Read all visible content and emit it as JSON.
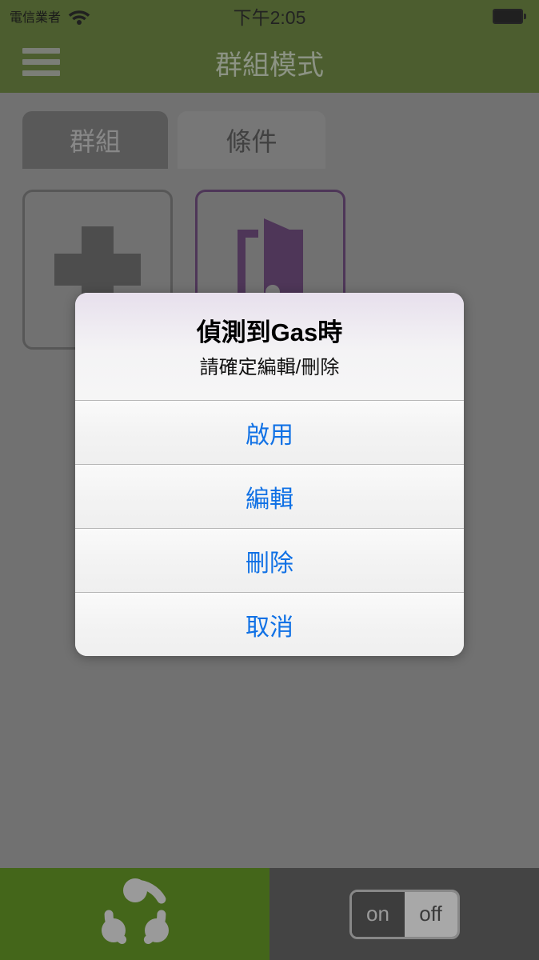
{
  "status_bar": {
    "carrier": "電信業者",
    "wifi_icon": "wifi-icon",
    "time": "下午2:05",
    "battery_icon": "battery-full-icon"
  },
  "nav_bar": {
    "menu_icon": "hamburger-menu-icon",
    "title": "群組模式"
  },
  "tabs": [
    {
      "label": "群組",
      "active": false
    },
    {
      "label": "條件",
      "active": true
    }
  ],
  "cards": [
    {
      "icon": "plus-icon",
      "label": ""
    },
    {
      "icon": "door-open-icon",
      "label": ""
    }
  ],
  "alert": {
    "title": "偵測到Gas時",
    "message": "請確定編輯/刪除",
    "buttons": [
      {
        "label": "啟用"
      },
      {
        "label": "編輯"
      },
      {
        "label": "刪除"
      },
      {
        "label": "取消"
      }
    ]
  },
  "bottom_bar": {
    "share_icon": "share-group-icon",
    "toggle": {
      "on_label": "on",
      "off_label": "off",
      "selected": "off"
    }
  },
  "colors": {
    "brand_green": "#4a6420",
    "bottom_green": "#44661a",
    "accent_purple": "#4d2a5c",
    "button_blue": "#1071e5",
    "dim_gray": "#808080",
    "tab_inactive": "#5e5e5e",
    "tab_active": "#8a8a8a",
    "bottom_dark": "#444444"
  }
}
